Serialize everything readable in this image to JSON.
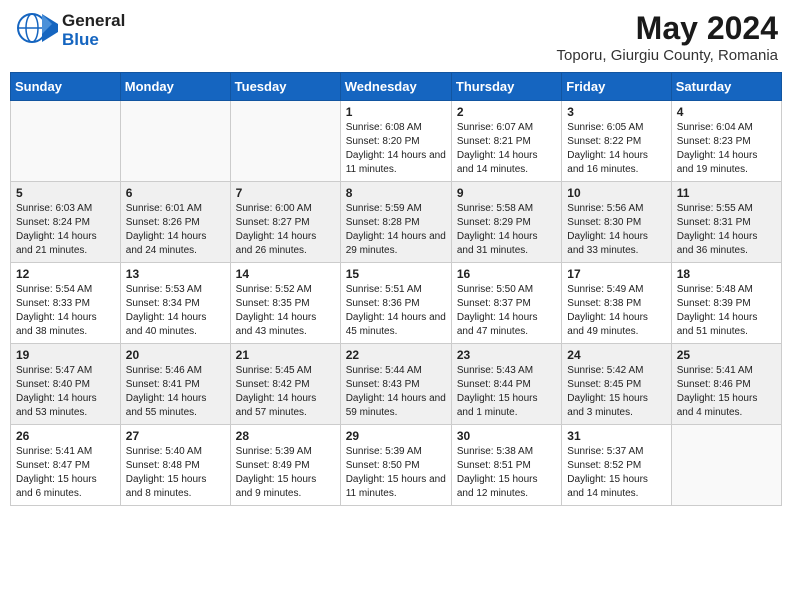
{
  "header": {
    "logo_general": "General",
    "logo_blue": "Blue",
    "month": "May 2024",
    "location": "Toporu, Giurgiu County, Romania"
  },
  "weekdays": [
    "Sunday",
    "Monday",
    "Tuesday",
    "Wednesday",
    "Thursday",
    "Friday",
    "Saturday"
  ],
  "weeks": [
    [
      {
        "day": "",
        "info": ""
      },
      {
        "day": "",
        "info": ""
      },
      {
        "day": "",
        "info": ""
      },
      {
        "day": "1",
        "info": "Sunrise: 6:08 AM\nSunset: 8:20 PM\nDaylight: 14 hours and 11 minutes."
      },
      {
        "day": "2",
        "info": "Sunrise: 6:07 AM\nSunset: 8:21 PM\nDaylight: 14 hours and 14 minutes."
      },
      {
        "day": "3",
        "info": "Sunrise: 6:05 AM\nSunset: 8:22 PM\nDaylight: 14 hours and 16 minutes."
      },
      {
        "day": "4",
        "info": "Sunrise: 6:04 AM\nSunset: 8:23 PM\nDaylight: 14 hours and 19 minutes."
      }
    ],
    [
      {
        "day": "5",
        "info": "Sunrise: 6:03 AM\nSunset: 8:24 PM\nDaylight: 14 hours and 21 minutes."
      },
      {
        "day": "6",
        "info": "Sunrise: 6:01 AM\nSunset: 8:26 PM\nDaylight: 14 hours and 24 minutes."
      },
      {
        "day": "7",
        "info": "Sunrise: 6:00 AM\nSunset: 8:27 PM\nDaylight: 14 hours and 26 minutes."
      },
      {
        "day": "8",
        "info": "Sunrise: 5:59 AM\nSunset: 8:28 PM\nDaylight: 14 hours and 29 minutes."
      },
      {
        "day": "9",
        "info": "Sunrise: 5:58 AM\nSunset: 8:29 PM\nDaylight: 14 hours and 31 minutes."
      },
      {
        "day": "10",
        "info": "Sunrise: 5:56 AM\nSunset: 8:30 PM\nDaylight: 14 hours and 33 minutes."
      },
      {
        "day": "11",
        "info": "Sunrise: 5:55 AM\nSunset: 8:31 PM\nDaylight: 14 hours and 36 minutes."
      }
    ],
    [
      {
        "day": "12",
        "info": "Sunrise: 5:54 AM\nSunset: 8:33 PM\nDaylight: 14 hours and 38 minutes."
      },
      {
        "day": "13",
        "info": "Sunrise: 5:53 AM\nSunset: 8:34 PM\nDaylight: 14 hours and 40 minutes."
      },
      {
        "day": "14",
        "info": "Sunrise: 5:52 AM\nSunset: 8:35 PM\nDaylight: 14 hours and 43 minutes."
      },
      {
        "day": "15",
        "info": "Sunrise: 5:51 AM\nSunset: 8:36 PM\nDaylight: 14 hours and 45 minutes."
      },
      {
        "day": "16",
        "info": "Sunrise: 5:50 AM\nSunset: 8:37 PM\nDaylight: 14 hours and 47 minutes."
      },
      {
        "day": "17",
        "info": "Sunrise: 5:49 AM\nSunset: 8:38 PM\nDaylight: 14 hours and 49 minutes."
      },
      {
        "day": "18",
        "info": "Sunrise: 5:48 AM\nSunset: 8:39 PM\nDaylight: 14 hours and 51 minutes."
      }
    ],
    [
      {
        "day": "19",
        "info": "Sunrise: 5:47 AM\nSunset: 8:40 PM\nDaylight: 14 hours and 53 minutes."
      },
      {
        "day": "20",
        "info": "Sunrise: 5:46 AM\nSunset: 8:41 PM\nDaylight: 14 hours and 55 minutes."
      },
      {
        "day": "21",
        "info": "Sunrise: 5:45 AM\nSunset: 8:42 PM\nDaylight: 14 hours and 57 minutes."
      },
      {
        "day": "22",
        "info": "Sunrise: 5:44 AM\nSunset: 8:43 PM\nDaylight: 14 hours and 59 minutes."
      },
      {
        "day": "23",
        "info": "Sunrise: 5:43 AM\nSunset: 8:44 PM\nDaylight: 15 hours and 1 minute."
      },
      {
        "day": "24",
        "info": "Sunrise: 5:42 AM\nSunset: 8:45 PM\nDaylight: 15 hours and 3 minutes."
      },
      {
        "day": "25",
        "info": "Sunrise: 5:41 AM\nSunset: 8:46 PM\nDaylight: 15 hours and 4 minutes."
      }
    ],
    [
      {
        "day": "26",
        "info": "Sunrise: 5:41 AM\nSunset: 8:47 PM\nDaylight: 15 hours and 6 minutes."
      },
      {
        "day": "27",
        "info": "Sunrise: 5:40 AM\nSunset: 8:48 PM\nDaylight: 15 hours and 8 minutes."
      },
      {
        "day": "28",
        "info": "Sunrise: 5:39 AM\nSunset: 8:49 PM\nDaylight: 15 hours and 9 minutes."
      },
      {
        "day": "29",
        "info": "Sunrise: 5:39 AM\nSunset: 8:50 PM\nDaylight: 15 hours and 11 minutes."
      },
      {
        "day": "30",
        "info": "Sunrise: 5:38 AM\nSunset: 8:51 PM\nDaylight: 15 hours and 12 minutes."
      },
      {
        "day": "31",
        "info": "Sunrise: 5:37 AM\nSunset: 8:52 PM\nDaylight: 15 hours and 14 minutes."
      },
      {
        "day": "",
        "info": ""
      }
    ]
  ]
}
